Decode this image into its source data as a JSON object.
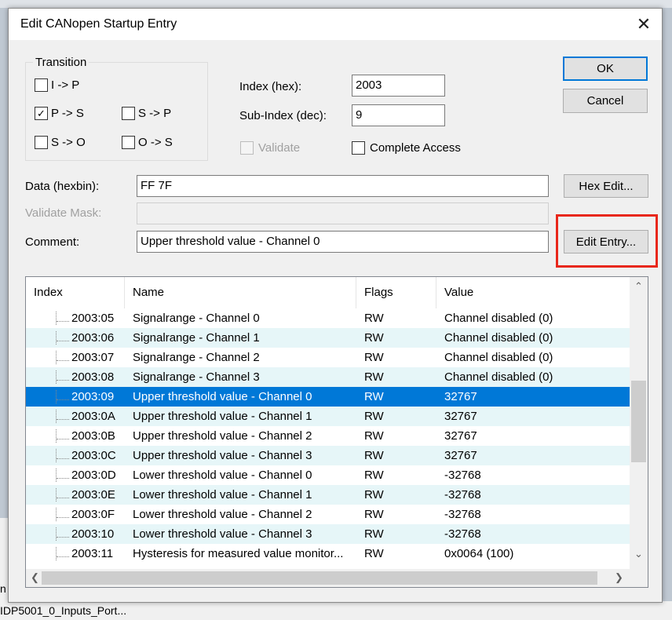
{
  "background": {
    "fragment_line1": "n",
    "fragment_line2": "IDP5001_0_Inputs_Port..."
  },
  "dialog": {
    "title": "Edit CANopen Startup Entry",
    "close_glyph": "✕"
  },
  "transition": {
    "label": "Transition",
    "items": [
      {
        "label": "I -> P",
        "checked": false
      },
      {
        "label": "P -> S",
        "checked": true
      },
      {
        "label": "S -> P",
        "checked": false
      },
      {
        "label": "S -> O",
        "checked": false
      },
      {
        "label": "O -> S",
        "checked": false
      }
    ]
  },
  "index": {
    "label": "Index (hex):",
    "value": "2003"
  },
  "subindex": {
    "label": "Sub-Index (dec):",
    "value": "9"
  },
  "validate": {
    "label": "Validate",
    "checked": false,
    "enabled": false
  },
  "complete_access": {
    "label": "Complete Access",
    "checked": false
  },
  "data": {
    "label": "Data (hexbin):",
    "value": "FF 7F"
  },
  "validate_mask": {
    "label": "Validate Mask:",
    "value": ""
  },
  "comment": {
    "label": "Comment:",
    "value": "Upper threshold value - Channel 0"
  },
  "buttons": {
    "ok": "OK",
    "cancel": "Cancel",
    "hex_edit": "Hex Edit...",
    "edit_entry": "Edit Entry..."
  },
  "list": {
    "columns": [
      "Index",
      "Name",
      "Flags",
      "Value"
    ],
    "rows": [
      {
        "index": "2003:05",
        "name": "Signalrange - Channel 0",
        "flags": "RW",
        "value": "Channel disabled (0)"
      },
      {
        "index": "2003:06",
        "name": "Signalrange - Channel 1",
        "flags": "RW",
        "value": "Channel disabled (0)"
      },
      {
        "index": "2003:07",
        "name": "Signalrange - Channel 2",
        "flags": "RW",
        "value": "Channel disabled (0)"
      },
      {
        "index": "2003:08",
        "name": "Signalrange - Channel 3",
        "flags": "RW",
        "value": "Channel disabled (0)"
      },
      {
        "index": "2003:09",
        "name": "Upper threshold value - Channel 0",
        "flags": "RW",
        "value": "32767",
        "selected": true
      },
      {
        "index": "2003:0A",
        "name": "Upper threshold value - Channel 1",
        "flags": "RW",
        "value": "32767"
      },
      {
        "index": "2003:0B",
        "name": "Upper threshold value - Channel 2",
        "flags": "RW",
        "value": "32767"
      },
      {
        "index": "2003:0C",
        "name": "Upper threshold value - Channel 3",
        "flags": "RW",
        "value": "32767"
      },
      {
        "index": "2003:0D",
        "name": "Lower threshold value - Channel 0",
        "flags": "RW",
        "value": "-32768"
      },
      {
        "index": "2003:0E",
        "name": "Lower threshold value - Channel 1",
        "flags": "RW",
        "value": "-32768"
      },
      {
        "index": "2003:0F",
        "name": "Lower threshold value - Channel 2",
        "flags": "RW",
        "value": "-32768"
      },
      {
        "index": "2003:10",
        "name": "Lower threshold value - Channel 3",
        "flags": "RW",
        "value": "-32768"
      },
      {
        "index": "2003:11",
        "name": "Hysteresis for measured value monitor...",
        "flags": "RW",
        "value": "0x0064 (100)"
      }
    ],
    "scroll_up": "⌃",
    "scroll_down": "⌄",
    "scroll_left": "❮",
    "scroll_right": "❯"
  },
  "colors": {
    "selection": "#0078d7",
    "alt_row": "#e6f6f8",
    "highlight_box": "#e8271b"
  }
}
